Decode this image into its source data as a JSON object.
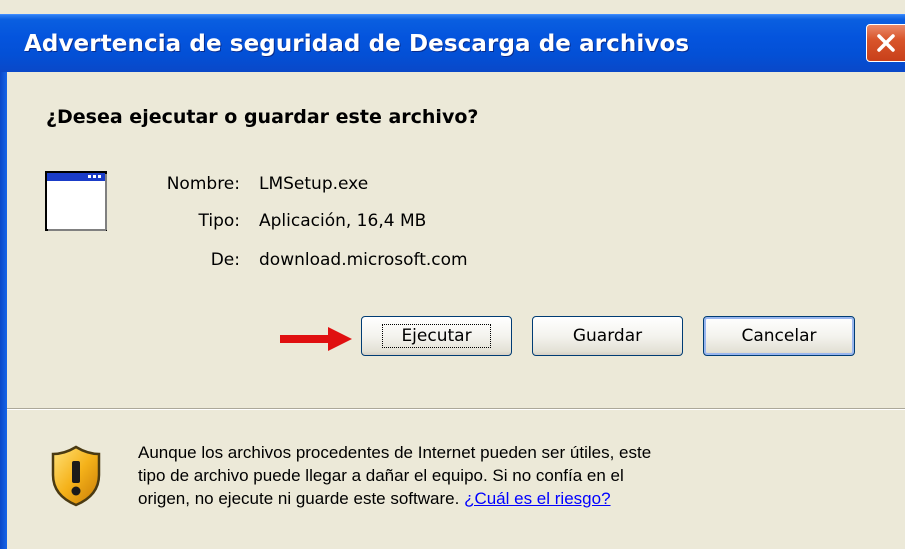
{
  "window": {
    "title": "Advertencia de seguridad de Descarga de archivos",
    "close_label": "Cerrar"
  },
  "dialog": {
    "question": "¿Desea ejecutar o guardar este archivo?",
    "file": {
      "name_label": "Nombre:",
      "name_value": "LMSetup.exe",
      "type_label": "Tipo:",
      "type_value": "Aplicación, 16,4 MB",
      "from_label": "De:",
      "from_value": "download.microsoft.com"
    },
    "buttons": {
      "run": "Ejecutar",
      "save": "Guardar",
      "cancel": "Cancelar"
    },
    "warning": {
      "line1": "Aunque los archivos procedentes de Internet pueden ser útiles, este",
      "line2": "tipo de archivo puede llegar a dañar el equipo. Si no confía en el",
      "line3_prefix": "origen, no ejecute ni guarde este software.",
      "link": "¿Cuál es el riesgo?"
    }
  },
  "colors": {
    "titlebar": "#0454dd",
    "dialog_bg": "#ece9d8",
    "arrow": "#e01010",
    "link": "#0000ff"
  },
  "icons": {
    "file": "application-window-icon",
    "shield": "security-shield-icon",
    "arrow": "red-right-arrow-icon",
    "close": "close-x-icon"
  }
}
